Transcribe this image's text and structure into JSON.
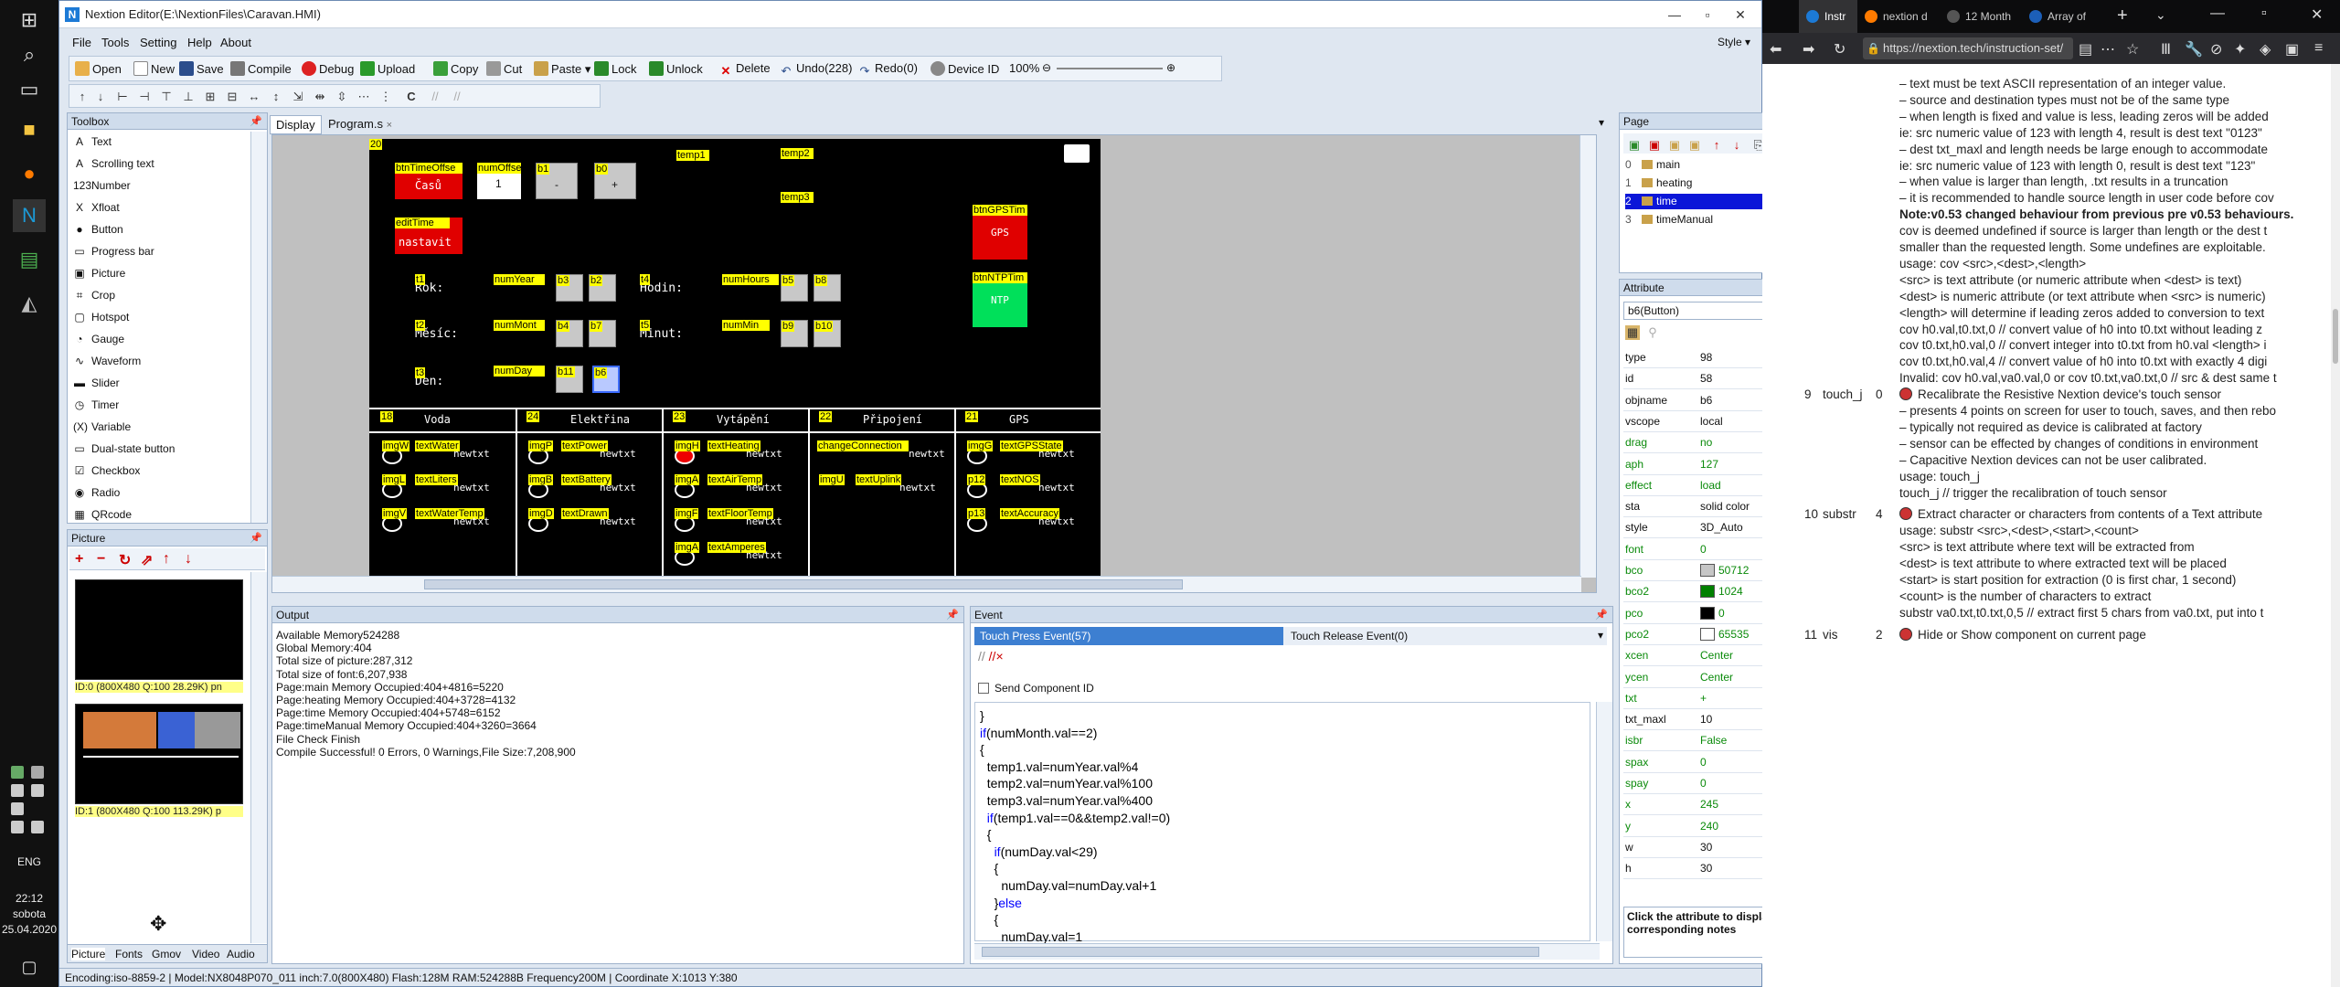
{
  "taskbar": {
    "time": "22:12",
    "day": "sobota",
    "date": "25.04.2020",
    "lang": "ENG"
  },
  "nextion": {
    "title": "Nextion Editor(E:\\NextionFiles\\Caravan.HMI)",
    "menu": [
      "File",
      "Tools",
      "Setting",
      "Help",
      "About"
    ],
    "style_label": "Style",
    "toolbar": {
      "open": "Open",
      "new": "New",
      "save": "Save",
      "compile": "Compile",
      "debug": "Debug",
      "upload": "Upload",
      "copy": "Copy",
      "cut": "Cut",
      "paste": "Paste",
      "lock": "Lock",
      "unlock": "Unlock",
      "delete": "Delete",
      "undo": "Undo(228)",
      "redo": "Redo(0)",
      "device_id": "Device ID",
      "zoom": "100%"
    },
    "toolbox": {
      "title": "Toolbox",
      "items": [
        "Text",
        "Scrolling text",
        "Number",
        "Xfloat",
        "Button",
        "Progress bar",
        "Picture",
        "Crop",
        "Hotspot",
        "Gauge",
        "Waveform",
        "Slider",
        "Timer",
        "Variable",
        "Dual-state button",
        "Checkbox",
        "Radio",
        "QRcode"
      ],
      "icons": [
        "A",
        "A",
        "123",
        "X",
        "●",
        "▭",
        "▣",
        "⌗",
        "▢",
        "◔",
        "∿",
        "▬",
        "◷",
        "(X)",
        "▭",
        "☑",
        "◉",
        "▦"
      ]
    },
    "picture_panel": {
      "title": "Picture",
      "items": [
        "ID:0  (800X480 Q:100 28.29K) pn",
        "ID:1  (800X480 Q:100 113.29K) p"
      ],
      "tabs": [
        "Picture",
        "Fonts",
        "Gmov",
        "Video",
        "Audio"
      ]
    },
    "doc_tabs": [
      "Display",
      "Program.s"
    ],
    "screen": {
      "page_id": "20",
      "labels": {
        "btnTimeOffset": "btnTimeOffse",
        "btnTimeOffset_text": "Časů",
        "numOffset": "numOffse",
        "numOffset_val": "1",
        "b1": "b1",
        "b1_text": "-",
        "b0": "b0",
        "b0_text": "+",
        "temp1": "temp1",
        "temp2": "temp2",
        "temp3": "temp3",
        "editTime": "editTime",
        "editTime_text": "nastavit",
        "btnGPSTime": "btnGPSTim",
        "btnGPSTime_text": "GPS",
        "btnNTPTime": "btnNTPTim",
        "btnNTPTime_text": "NTP",
        "rok": "Rok:",
        "mesic": "Měsíc:",
        "den": "Den:",
        "hodin": "Hodin:",
        "minut": "Minut:",
        "numYear": "numYear",
        "numMonth": "numMont",
        "numDay": "numDay",
        "numHours": "numHours",
        "numMin": "numMin",
        "b3": "b3",
        "b2": "b2",
        "b4": "b4",
        "b7": "b7",
        "b11": "b11",
        "b6": "b6",
        "b5": "b5",
        "b8": "b8",
        "b9": "b9",
        "b10": "b10",
        "t1": "t1",
        "t2": "t2",
        "t3": "t3",
        "t4": "t4",
        "t5": "t5",
        "sec_voda": "Voda",
        "sec_elektrina": "Elektřina",
        "sec_vytapeni": "Vytápění",
        "sec_pripojeni": "Připojení",
        "sec_gps": "GPS",
        "id18": "18",
        "id24": "24",
        "id23": "23",
        "id22": "22",
        "id21": "21",
        "imgW": "imgW",
        "imgL": "imgL",
        "imgV": "imgV",
        "textWater": "textWater",
        "textLiters": "textLiters",
        "textWaterTemp": "textWaterTemp",
        "imgP": "imgP",
        "imgB": "imgB",
        "imgD": "imgD",
        "textPower": "textPower",
        "textBattery": "textBattery",
        "textDrawn": "textDrawn",
        "imgH": "imgH",
        "imgA": "imgA",
        "imgF": "imgF",
        "imgAm": "imgA",
        "textHeating": "textHeating",
        "textAirTemp": "textAirTemp",
        "textFloorTemp": "textFloorTemp",
        "textAmperes": "textAmperes",
        "changeConnection": "changeConnection",
        "imgU": "imgU",
        "textUplink": "textUplink",
        "imgG": "imgG",
        "textGPSState": "textGPSState",
        "p12": "p12",
        "textNOS": "textNOS",
        "p13": "p13",
        "textAccuracy": "textAccuracy",
        "newtxt": "newtxt"
      }
    },
    "output": {
      "title": "Output",
      "lines": [
        "Available Memory524288",
        "Global Memory:404",
        "Total size of picture:287,312",
        "Total size of font:6,207,938",
        "Page:main Memory Occupied:404+4816=5220",
        "Page:heating Memory Occupied:404+3728=4132",
        "Page:time Memory Occupied:404+5748=6152",
        "Page:timeManual Memory Occupied:404+3260=3664",
        "File Check Finish",
        "Compile Successful! 0 Errors, 0 Warnings,File Size:7,208,900"
      ]
    },
    "event": {
      "title": "Event",
      "tab_press": "Touch Press Event(57)",
      "tab_release": "Touch Release Event(0)",
      "send_component_id": "Send Component ID",
      "code": [
        "}",
        "if(numMonth.val==2)",
        "{",
        "  temp1.val=numYear.val%4",
        "  temp2.val=numYear.val%100",
        "  temp3.val=numYear.val%400",
        "  if(temp1.val==0&&temp2.val!=0)",
        "  {",
        "    if(numDay.val<29)",
        "    {",
        "      numDay.val=numDay.val+1",
        "    }else",
        "    {",
        "      numDay.val=1"
      ]
    },
    "page_panel": {
      "title": "Page",
      "pages": [
        {
          "id": "0",
          "name": "main"
        },
        {
          "id": "1",
          "name": "heating"
        },
        {
          "id": "2",
          "name": "time"
        },
        {
          "id": "3",
          "name": "timeManual"
        }
      ],
      "selected": 2
    },
    "attribute_panel": {
      "title": "Attribute",
      "selector": "b6(Button)",
      "rows": [
        {
          "k": "type",
          "v": "98",
          "g": false
        },
        {
          "k": "id",
          "v": "58",
          "g": false
        },
        {
          "k": "objname",
          "v": "b6",
          "g": false
        },
        {
          "k": "vscope",
          "v": "local",
          "g": false
        },
        {
          "k": "drag",
          "v": "no",
          "g": true
        },
        {
          "k": "aph",
          "v": "127",
          "g": true
        },
        {
          "k": "effect",
          "v": "load",
          "g": true
        },
        {
          "k": "sta",
          "v": "solid color",
          "g": false
        },
        {
          "k": "style",
          "v": "3D_Auto",
          "g": false
        },
        {
          "k": "font",
          "v": "0",
          "g": true
        },
        {
          "k": "bco",
          "v": "50712",
          "g": true,
          "sw": "#c6c6c6"
        },
        {
          "k": "bco2",
          "v": "1024",
          "g": true,
          "sw": "#008000"
        },
        {
          "k": "pco",
          "v": "0",
          "g": true,
          "sw": "#000000"
        },
        {
          "k": "pco2",
          "v": "65535",
          "g": true,
          "sw": "#ffffff"
        },
        {
          "k": "xcen",
          "v": "Center",
          "g": true
        },
        {
          "k": "ycen",
          "v": "Center",
          "g": true
        },
        {
          "k": "txt",
          "v": "+",
          "g": true
        },
        {
          "k": "txt_maxl",
          "v": "10",
          "g": false
        },
        {
          "k": "isbr",
          "v": "False",
          "g": true
        },
        {
          "k": "spax",
          "v": "0",
          "g": true
        },
        {
          "k": "spay",
          "v": "0",
          "g": true
        },
        {
          "k": "x",
          "v": "245",
          "g": true
        },
        {
          "k": "y",
          "v": "240",
          "g": true
        },
        {
          "k": "w",
          "v": "30",
          "g": false
        },
        {
          "k": "h",
          "v": "30",
          "g": false
        }
      ],
      "note": "Click the attribute to display corresponding notes"
    },
    "status": "Encoding:iso-8859-2 | Model:NX8048P070_011 inch:7.0(800X480) Flash:128M RAM:524288B Frequency200M |    Coordinate X:1013  Y:380"
  },
  "browser": {
    "tabs": [
      "Instr",
      "nextion d",
      "12 Month",
      "Array of"
    ],
    "url": "https://nextion.tech/instruction-set/",
    "lines": [
      "– text must be text ASCII representation of an integer value.",
      "– source and destination types must not be of the same type",
      "– when length is fixed and value is less, leading zeros will be added",
      "ie: src numeric value of 123 with length 4, result is dest text \"0123\"",
      "– dest txt_maxl and length needs be large enough to accommodate",
      "ie: src numeric value of 123 with length 0, result is dest text \"123\"",
      "– when value is larger than length, .txt results in a truncation",
      "– it is recommended to handle source length in user code before cov",
      "Note:v0.53 changed behaviour from previous pre v0.53 behaviours.",
      "cov is deemed undefined if source is larger than length or the dest t",
      "smaller than the requested length. Some undefines are exploitable.",
      "usage: cov <src>,<dest>,<length>",
      "<src> is text attribute (or numeric attribute when <dest> is text)",
      "<dest> is numeric attribute (or text attribute when <src> is numeric)",
      "<length> will determine if leading zeros added to conversion to text",
      "cov h0.val,t0.txt,0 // convert value of h0 into t0.txt without leading z",
      "cov t0.txt,h0.val,0 // convert integer into t0.txt from h0.val <length> i",
      "cov t0.txt,h0.val,4 // convert value of h0 into t0.txt with exactly 4 digi",
      "Invalid: cov h0.val,va0.val,0 or cov t0.txt,va0.txt,0 // src & dest same t"
    ],
    "entries": [
      {
        "num": "9",
        "name": "touch_j",
        "args": "0",
        "title": "Recalibrate the Resistive Nextion device's touch sensor",
        "lines": [
          "– presents 4 points on screen for user to touch, saves, and then rebo",
          "– typically not required as device is calibrated at factory",
          "– sensor can be effected by changes of conditions in environment",
          "– Capacitive Nextion devices can not be user calibrated.",
          "usage: touch_j",
          "touch_j // trigger the recalibration of touch sensor"
        ]
      },
      {
        "num": "10",
        "name": "substr",
        "args": "4",
        "title": "Extract character or characters from contents of a Text attribute",
        "lines": [
          "usage: substr <src>,<dest>,<start>,<count>",
          "<src> is text attribute where text will be extracted from",
          "<dest> is text attribute to where extracted text will be placed",
          "<start> is start position for extraction (0 is first char, 1 second)",
          "<count> is the number of characters to extract",
          "substr va0.txt,t0.txt,0,5 // extract first 5 chars from va0.txt, put into t"
        ]
      },
      {
        "num": "11",
        "name": "vis",
        "args": "2",
        "title": "Hide or Show component on current page",
        "lines": []
      }
    ]
  }
}
